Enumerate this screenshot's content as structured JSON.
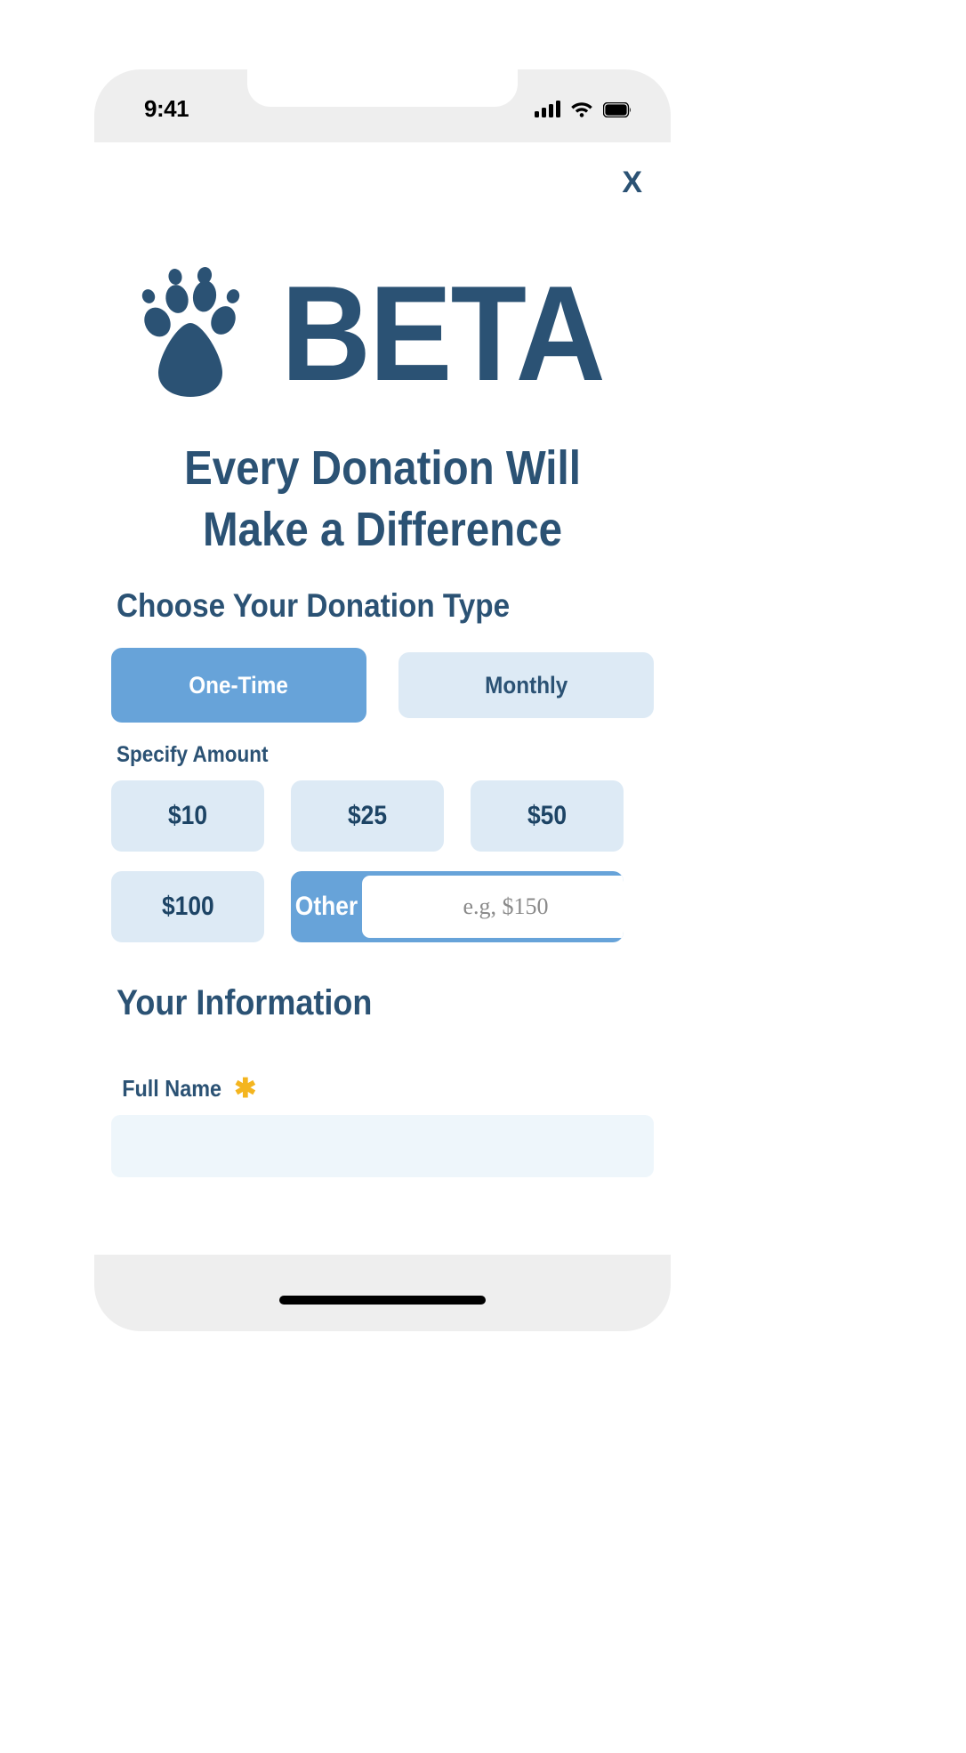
{
  "status_bar": {
    "time": "9:41",
    "signal_icon": "cellular-signal-icon",
    "wifi_icon": "wifi-icon",
    "battery_icon": "battery-icon"
  },
  "header": {
    "close_label": "X",
    "brand_name": "BETA",
    "logo_icon": "paw-print-icon",
    "headline_line1": "Every Donation Will",
    "headline_line2": "Make a Difference"
  },
  "donation_type": {
    "title": "Choose Your Donation Type",
    "options": [
      {
        "label": "One-Time",
        "selected": true
      },
      {
        "label": "Monthly",
        "selected": false
      }
    ]
  },
  "amount": {
    "label": "Specify Amount",
    "presets": [
      {
        "label": "$10",
        "selected": false
      },
      {
        "label": "$25",
        "selected": false
      },
      {
        "label": "$50",
        "selected": false
      },
      {
        "label": "$100",
        "selected": false
      }
    ],
    "other": {
      "label": "Other",
      "selected": true,
      "placeholder": "e.g, $150",
      "value": ""
    }
  },
  "your_information": {
    "title": "Your Information",
    "fields": [
      {
        "label": "Full Name",
        "required_marker": "✱",
        "placeholder": "",
        "value": ""
      }
    ]
  },
  "colors": {
    "navy": "#2b5274",
    "accent_blue": "#67a3d9",
    "light_blue": "#ddeaf5",
    "field_bg": "#eef6fb",
    "required_yellow": "#f4b51f"
  }
}
